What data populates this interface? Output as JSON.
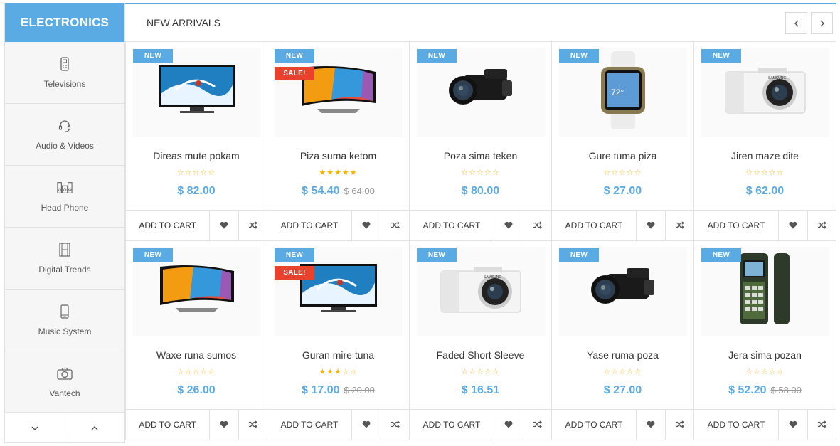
{
  "sidebar": {
    "title": "ELECTRONICS",
    "categories": [
      {
        "label": "Televisions",
        "icon": "remote-icon"
      },
      {
        "label": "Audio & Videos",
        "icon": "headset-icon"
      },
      {
        "label": "Head Phone",
        "icon": "speakers-icon"
      },
      {
        "label": "Digital Trends",
        "icon": "film-icon"
      },
      {
        "label": "Music System",
        "icon": "phone-icon"
      },
      {
        "label": "Vantech",
        "icon": "camera-icon"
      }
    ],
    "nav_down": "⌄",
    "nav_up": "⌃"
  },
  "header": {
    "title": "NEW ARRIVALS",
    "prev": "‹",
    "next": "›"
  },
  "colors": {
    "accent": "#5aaae3",
    "sale": "#e8412c",
    "star": "#f4b400"
  },
  "products": [
    {
      "name": "Direas mute pokam",
      "badge_new": "NEW",
      "badge_sale": "",
      "stars": "☆☆☆☆☆",
      "price": "$ 82.00",
      "old_price": "",
      "image": "tv-icon",
      "add": "ADD TO CART"
    },
    {
      "name": "Piza suma ketom",
      "badge_new": "NEW",
      "badge_sale": "SALE!",
      "stars": "★★★★★",
      "price": "$ 54.40",
      "old_price": "$ 64.00",
      "image": "curved-tv-icon",
      "add": "ADD TO CART"
    },
    {
      "name": "Poza sima teken",
      "badge_new": "NEW",
      "badge_sale": "",
      "stars": "☆☆☆☆☆",
      "price": "$ 80.00",
      "old_price": "",
      "image": "camcorder-icon",
      "add": "ADD TO CART"
    },
    {
      "name": "Gure tuma piza",
      "badge_new": "NEW",
      "badge_sale": "",
      "stars": "☆☆☆☆☆",
      "price": "$ 27.00",
      "old_price": "",
      "image": "smartwatch-icon",
      "add": "ADD TO CART"
    },
    {
      "name": "Jiren maze dite",
      "badge_new": "NEW",
      "badge_sale": "",
      "stars": "☆☆☆☆☆",
      "price": "$ 62.00",
      "old_price": "",
      "image": "camera-icon",
      "add": "ADD TO CART"
    },
    {
      "name": "Waxe runa sumos",
      "badge_new": "NEW",
      "badge_sale": "",
      "stars": "☆☆☆☆☆",
      "price": "$ 26.00",
      "old_price": "",
      "image": "curved-tv-icon",
      "add": "ADD TO CART"
    },
    {
      "name": "Guran mire tuna",
      "badge_new": "NEW",
      "badge_sale": "SALE!",
      "stars": "★★★☆☆",
      "price": "$ 17.00",
      "old_price": "$ 20.00",
      "image": "tv-icon",
      "add": "ADD TO CART"
    },
    {
      "name": "Faded Short Sleeve",
      "badge_new": "NEW",
      "badge_sale": "",
      "stars": "☆☆☆☆☆",
      "price": "$ 16.51",
      "old_price": "",
      "image": "camera-icon",
      "add": "ADD TO CART"
    },
    {
      "name": "Yase ruma poza",
      "badge_new": "NEW",
      "badge_sale": "",
      "stars": "☆☆☆☆☆",
      "price": "$ 27.00",
      "old_price": "",
      "image": "camcorder-icon",
      "add": "ADD TO CART"
    },
    {
      "name": "Jera sima pozan",
      "badge_new": "NEW",
      "badge_sale": "",
      "stars": "☆☆☆☆☆",
      "price": "$ 52.20",
      "old_price": "$ 58.00",
      "image": "rugged-phone-icon",
      "add": "ADD TO CART"
    }
  ]
}
